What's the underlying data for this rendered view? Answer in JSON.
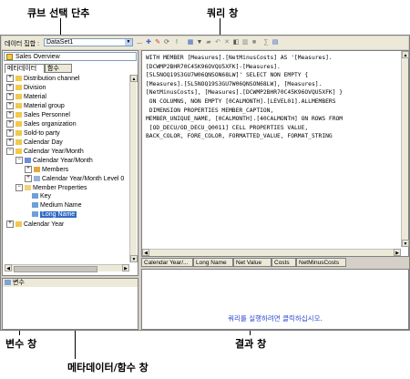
{
  "callouts": {
    "cube_selector": "큐브 선택 단추",
    "query_pane": "쿼리 창",
    "parameters_pane": "변수 창",
    "results_pane": "결과 창",
    "metadata_pane": "메타데이터/함수 창"
  },
  "toolbar": {
    "dataset_label": "데이터 집합 :",
    "dataset_value": "DataSet1",
    "ellipsis": "..."
  },
  "cube_selector": {
    "value": "Sales Overview"
  },
  "metadata_tabs": [
    {
      "label": "메타데이터"
    },
    {
      "label": "함수"
    }
  ],
  "tree": [
    {
      "label": "Distribution channel"
    },
    {
      "label": "Division"
    },
    {
      "label": "Material"
    },
    {
      "label": "Material group"
    },
    {
      "label": "Sales Personnel"
    },
    {
      "label": "Sales organization"
    },
    {
      "label": "Sold-to party"
    },
    {
      "label": "Calendar Day"
    },
    {
      "label": "Calendar Year/Month"
    },
    {
      "label": "Calendar Year/Month"
    },
    {
      "label": "Members"
    },
    {
      "label": "Calendar Year/Month Level 0"
    },
    {
      "label": "Member Properties"
    },
    {
      "label": "Key"
    },
    {
      "label": "Medium Name"
    },
    {
      "label": "Long Name"
    },
    {
      "label": "Calendar Year"
    }
  ],
  "query_text": "WITH MEMBER [Measures].[NetMinusCosts] AS '[Measures].\n[DCWMP2BHR70C45K96OVQU5XFK]-[Measures].\n[5L5NOQ19S3GU7W06QNSON68LW]' SELECT NON EMPTY {\n[Measures].[5L5NOQ19S3GU7W06QNSON68LW], [Measures].\n[NetMinusCosts], [Measures].[DCWMP2BHR70C45K96OVQU5XFK] }\n ON COLUMNS, NON EMPTY [0CALMONTH].[LEVEL01].ALLMEMBERS\n DIMENSION PROPERTIES MEMBER_CAPTION,\nMEMBER_UNIQUE_NAME, [0CALMONTH].[40CALMONTH] ON ROWS FROM\n [OD_DECU/OD_DECU_Q0011] CELL PROPERTIES VALUE,\nBACK_COLOR, FORE_COLOR, FORMATTED_VALUE, FORMAT_STRING",
  "result_columns": [
    {
      "label": "Calendar Year/..."
    },
    {
      "label": "Long Name"
    },
    {
      "label": "Net Value"
    },
    {
      "label": "Costs"
    },
    {
      "label": "NetMinusCosts"
    }
  ],
  "results": {
    "prompt": "쿼리를 실행하려면 클릭하십시오."
  },
  "parameters": {
    "header": "변수"
  },
  "colors": {
    "window_bg": "#d4d0c8",
    "toolbar_bg": "#ece9d8",
    "selection": "#316ac5",
    "link_blue": "#2a4bd1"
  }
}
